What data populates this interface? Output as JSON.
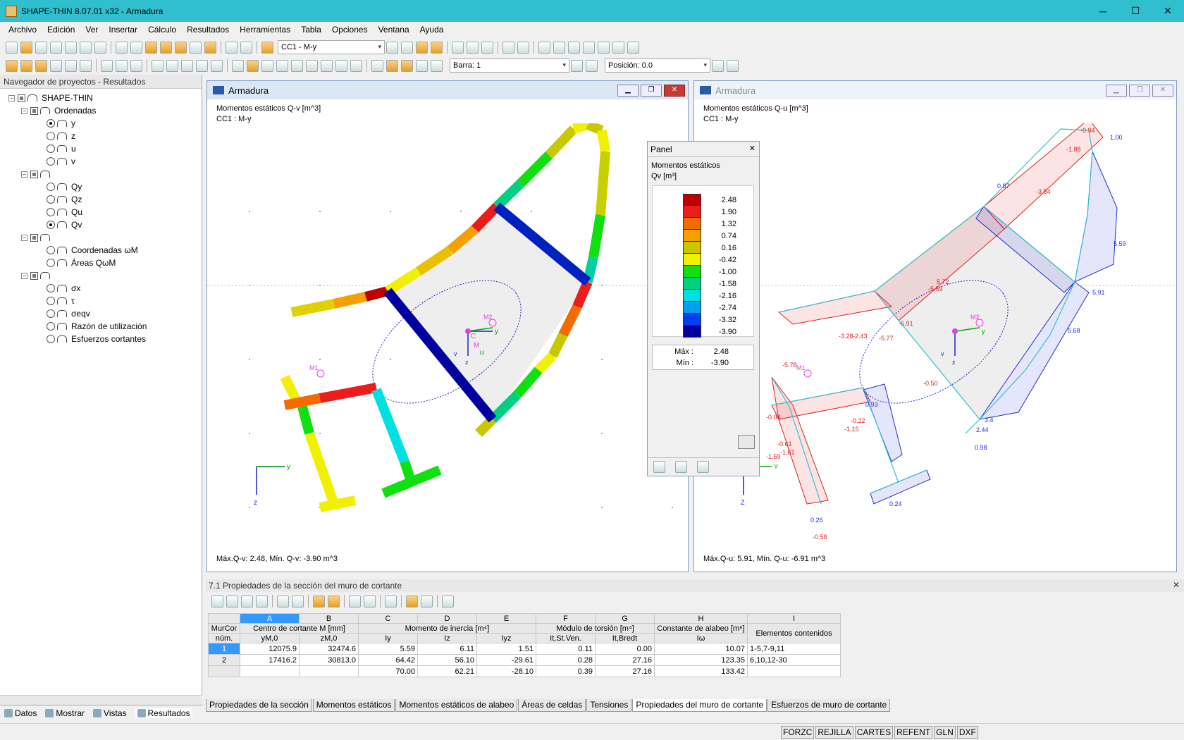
{
  "app": {
    "title": "SHAPE-THIN 8.07.01 x32 - Armadura"
  },
  "window_controls": {
    "minimize": "─",
    "maximize": "☐",
    "close": "✕"
  },
  "menu": [
    "Archivo",
    "Edición",
    "Ver",
    "Insertar",
    "Cálculo",
    "Resultados",
    "Herramientas",
    "Tabla",
    "Opciones",
    "Ventana",
    "Ayuda"
  ],
  "toolbar": {
    "loadcase": "CC1 - M-y",
    "bar": "Barra: 1",
    "position": "Posición: 0.0"
  },
  "navigator": {
    "title": "Navegador de proyectos - Resultados",
    "root": "SHAPE-THIN",
    "ordenadas": "Ordenadas",
    "ordenadas_items": [
      "y",
      "z",
      "u",
      "v"
    ],
    "q_items": [
      "Qy",
      "Qz",
      "Qu",
      "Qv"
    ],
    "coord": "Coordenadas ωM",
    "areas": "Áreas QωM",
    "stress_items": [
      "σx",
      "τ",
      "σeqv",
      "Razón de utilización",
      "Esfuerzos cortantes"
    ],
    "tabs": [
      "Datos",
      "Mostrar",
      "Vistas",
      "Resultados"
    ]
  },
  "view_left": {
    "title": "Armadura",
    "line1": "Momentos estáticos Q-v [m^3]",
    "line2": "CC1 : M-y",
    "footer": "Máx.Q-v: 2.48, Mín. Q-v: -3.90 m^3",
    "labels": {
      "m1": "M1",
      "m2": "M2",
      "y": "y",
      "z": "z",
      "u": "u",
      "v": "v",
      "c": "C",
      "m": "M"
    }
  },
  "view_right": {
    "title": "Armadura",
    "line1": "Momentos estáticos Q-u [m^3]",
    "line2": "CC1 : M-y",
    "footer": "Máx.Q-u: 5.91, Mín. Q-u: -6.91 m^3",
    "labels": {
      "m1": "M1",
      "m2": "M2",
      "y": "Y",
      "z": "Z",
      "y2": "y",
      "z2": "z",
      "v": "v"
    },
    "value_labels": [
      "-0.94",
      "-1.88",
      "1.00",
      "-3.54",
      "0.87",
      "5.59",
      "5.91",
      "5.72",
      "-5.59",
      "5.68",
      "-6.91",
      "-2.43",
      "-3.28",
      "-5.77",
      "-5.78",
      "-0.50",
      "0.93",
      "-0.04",
      "-0.22",
      "-1.15",
      "-0.61",
      "-1.61",
      "-1.59",
      "3.4",
      "2.44",
      "0.98",
      "0.24",
      "0.26",
      "-0.58"
    ]
  },
  "panel": {
    "title": "Panel",
    "subtitle": "Momentos estáticos",
    "unit": "Qv [m³]",
    "legend": [
      {
        "color": "#c00000",
        "value": "2.48"
      },
      {
        "color": "#ec1c1c",
        "value": "1.90"
      },
      {
        "color": "#f56a00",
        "value": "1.32"
      },
      {
        "color": "#f5a000",
        "value": "0.74"
      },
      {
        "color": "#c8c800",
        "value": "0.16"
      },
      {
        "color": "#f0f000",
        "value": "-0.42"
      },
      {
        "color": "#10e010",
        "value": "-1.00"
      },
      {
        "color": "#00d080",
        "value": "-1.58"
      },
      {
        "color": "#00e0e0",
        "value": "-2.16"
      },
      {
        "color": "#00a0f0",
        "value": "-2.74"
      },
      {
        "color": "#0040f0",
        "value": "-3.32"
      },
      {
        "color": "#0000a0",
        "value": "-3.90"
      }
    ],
    "max_label": "Máx  :",
    "max_value": "2.48",
    "min_label": "Mín  :",
    "min_value": "-3.90"
  },
  "table": {
    "title": "7.1 Propiedades de la sección del muro de cortante",
    "col_letters": [
      "A",
      "B",
      "C",
      "D",
      "E",
      "F",
      "G",
      "H",
      "I"
    ],
    "h_murcor": "MurCor",
    "h_num": "núm.",
    "h_centro": "Centro de cortante M [mm]",
    "h_inercia": "Momento de inercia [m⁴]",
    "h_torsion": "Módulo de torsión [m⁴]",
    "h_alabeo": "Constante de alabeo [m⁶]",
    "h_elementos": "Elementos contenidos",
    "sub": [
      "yM,0",
      "zM,0",
      "Iy",
      "Iz",
      "Iyz",
      "It,St.Ven.",
      "It,Bredt",
      "Iω"
    ],
    "rows": [
      {
        "n": "1",
        "a": "12075.9",
        "b": "32474.6",
        "c": "5.59",
        "d": "6.11",
        "e": "1.51",
        "f": "0.11",
        "g": "0.00",
        "h": "10.07",
        "i": "1-5,7-9,11"
      },
      {
        "n": "2",
        "a": "17416.2",
        "b": "30813.0",
        "c": "64.42",
        "d": "56.10",
        "e": "-29.61",
        "f": "0.28",
        "g": "27.16",
        "h": "123.35",
        "i": "6,10,12-30"
      },
      {
        "n": "",
        "a": "",
        "b": "",
        "c": "70.00",
        "d": "62.21",
        "e": "-28.10",
        "f": "0.39",
        "g": "27.16",
        "h": "133.42",
        "i": ""
      }
    ]
  },
  "bottom_tabs": [
    "Propiedades de la sección",
    "Momentos estáticos",
    "Momentos estáticos de alabeo",
    "Áreas de celdas",
    "Tensiones",
    "Propiedades del muro de cortante",
    "Esfuerzos de muro de cortante"
  ],
  "status": [
    "FORZC",
    "REJILLA",
    "CARTES",
    "REFENT",
    "GLN",
    "DXF"
  ]
}
